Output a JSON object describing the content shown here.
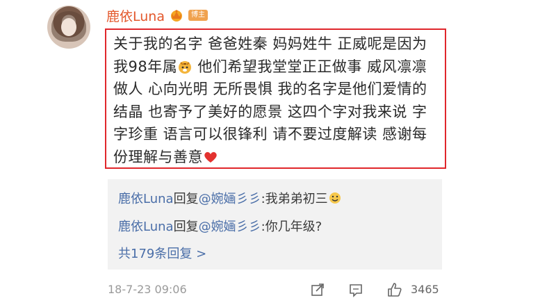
{
  "user": {
    "name": "鹿依Luna",
    "badge": "博主"
  },
  "post": {
    "text": "关于我的名字 爸爸姓秦 妈妈姓牛 正威呢是因为我98年属",
    "text_after_emoji": " 他们希望我堂堂正正做事 威风凛凛做人 心向光明 无所畏惧 我的名字是他们爱情的结晶 也寄予了美好的愿景 这四个字对我来说 字字珍重 语言可以很锋利 请不要过度解读 感谢每份理解与善意"
  },
  "replies": [
    {
      "author": "鹿依Luna",
      "verb": "回复",
      "target": "@婉婳彡彡",
      "content": ":我弟弟初三"
    },
    {
      "author": "鹿依Luna",
      "verb": "回复",
      "target": "@婉婳彡彡",
      "content": ":你几年级?"
    }
  ],
  "total_replies": "共179条回复 >",
  "footer": {
    "timestamp": "18-7-23 09:06",
    "like_count": "3465"
  },
  "colors": {
    "username": "#e3572b",
    "highlight_border": "#e0262b",
    "link": "#4a6ea8",
    "reply_bg": "#f2f2f2"
  }
}
